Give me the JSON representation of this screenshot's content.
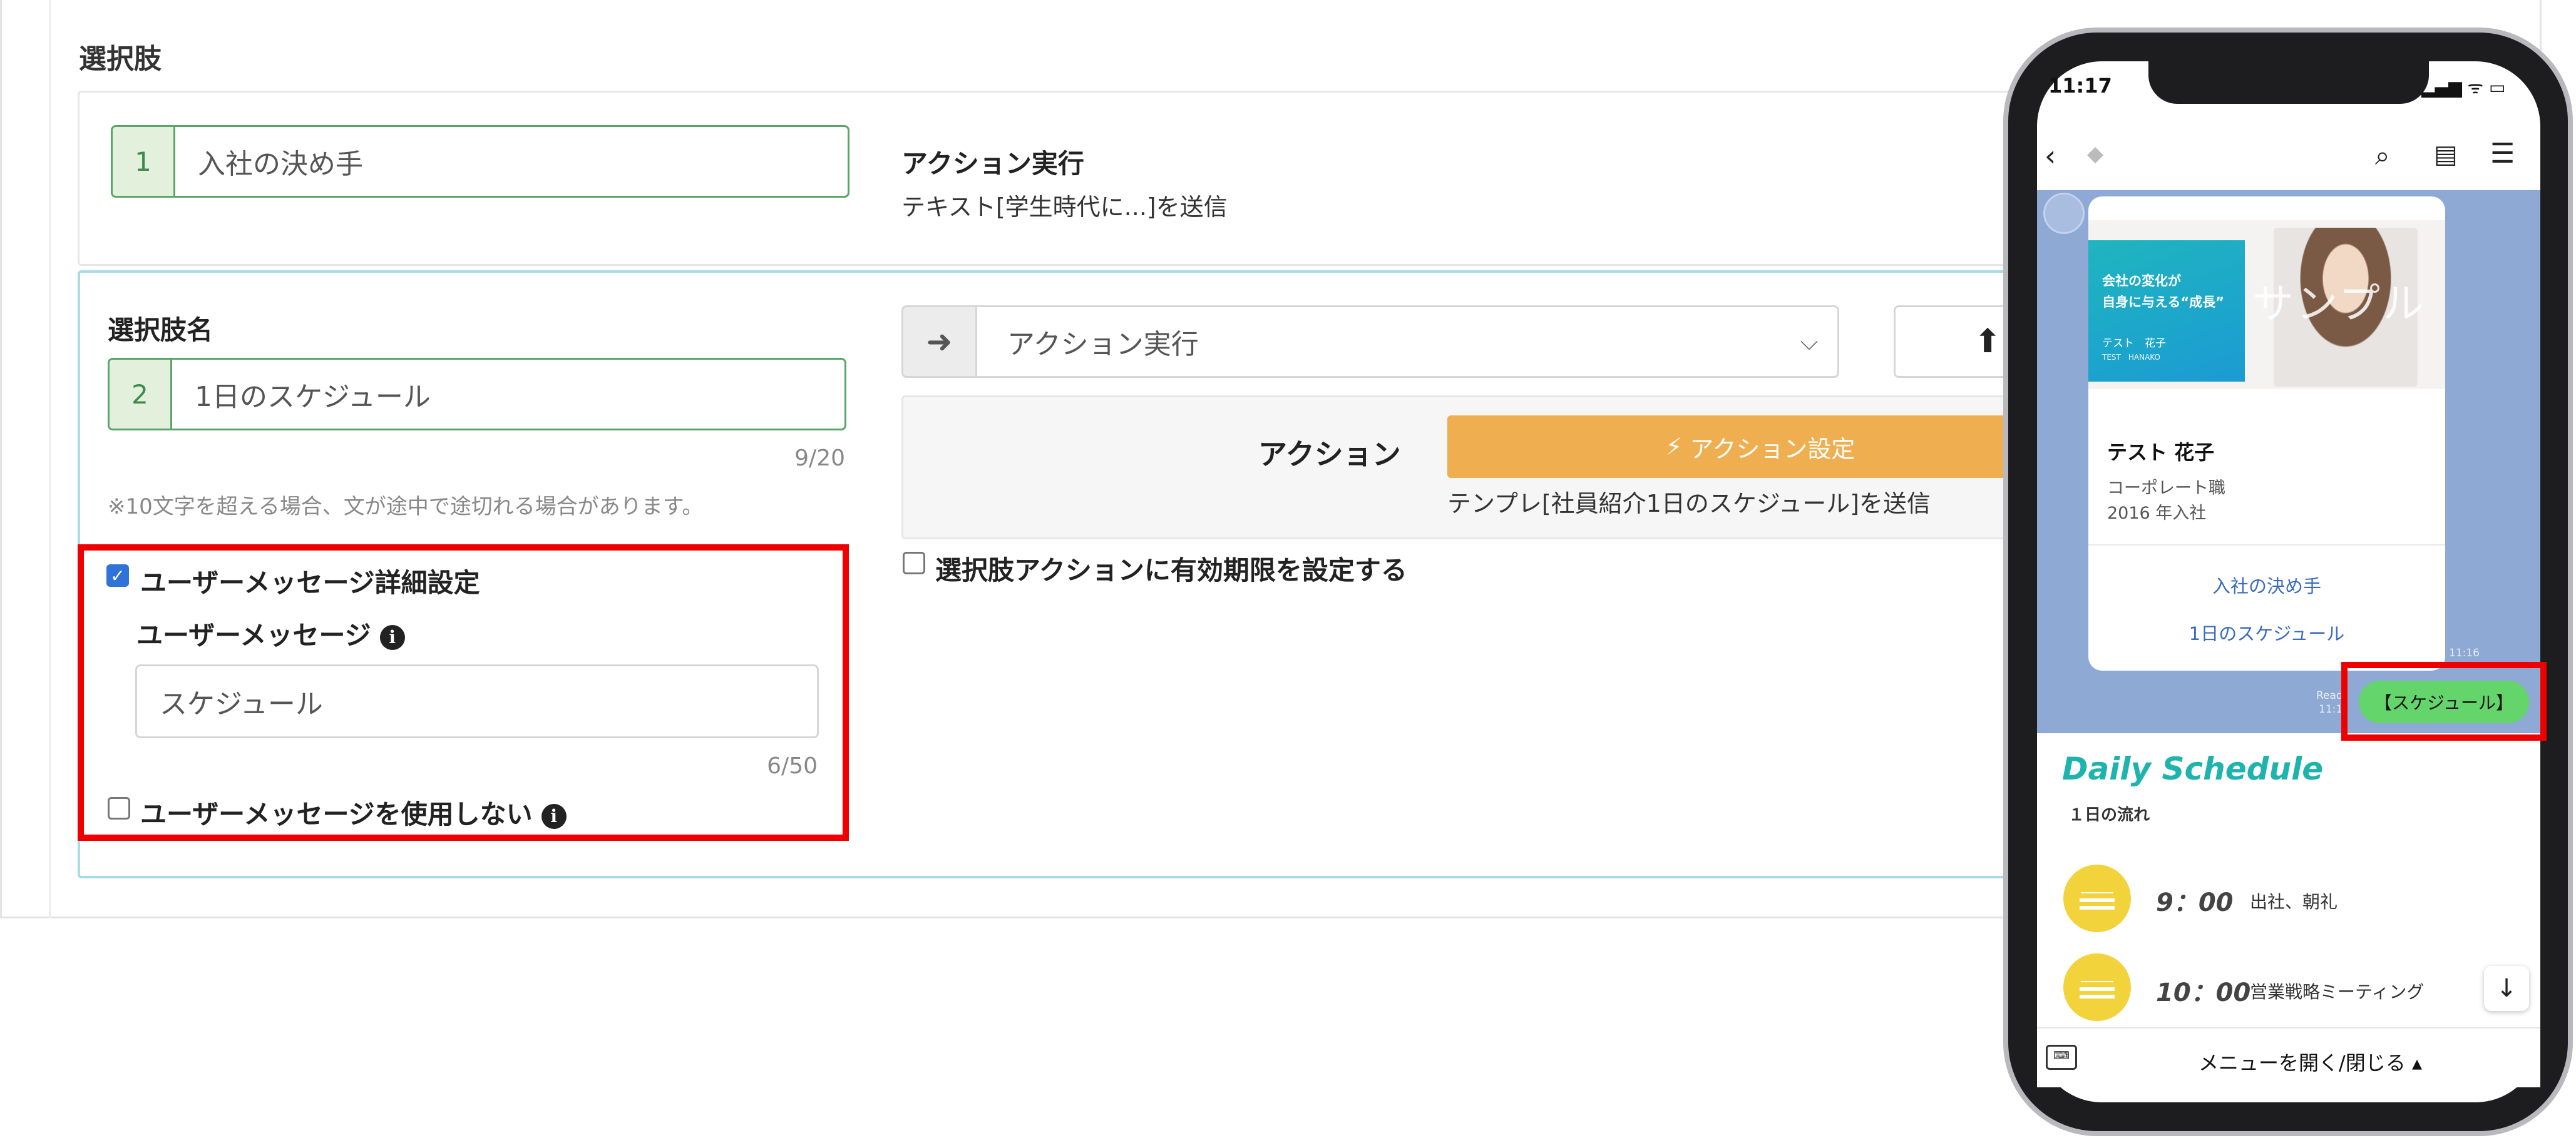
{
  "section": {
    "title": "選択肢"
  },
  "choice1": {
    "number": "1",
    "value": "入社の決め手",
    "action_title": "アクション実行",
    "action_desc": "テキスト[学生時代に...]を送信"
  },
  "choice2": {
    "label": "選択肢名",
    "number": "2",
    "value": "1日のスケジュール",
    "counter": "9/20",
    "hint": "※10文字を超える場合、文が途中で途切れる場合があります。",
    "select_value": "アクション実行",
    "action_label": "アクション",
    "action_button": "アクション設定",
    "action_desc": "テンプレ[社員紹介1日のスケジュール]を送信",
    "expiry_label": "選択肢アクションに有効期限を設定する",
    "detail_label": "ユーザーメッセージ詳細設定",
    "user_message_label": "ユーザーメッセージ",
    "user_message_value": "スケジュール",
    "user_message_counter": "6/50",
    "no_message_label": "ユーザーメッセージを使用しない"
  },
  "phone": {
    "time": "11:17",
    "card": {
      "headline1": "会社の変化が",
      "headline2": "自身に与える“成長”",
      "name_jp": "テスト　花子",
      "name_en": "TEST　HANAKO",
      "watermark": "サンプル",
      "person_name": "テスト 花子",
      "role": "コーポレート職",
      "year": "2016 年入社",
      "option1": "入社の決め手",
      "option2": "1日のスケジュール",
      "time": "11:16"
    },
    "read": "Read",
    "read_time": "11:1",
    "bubble": "【スケジュール】",
    "daily_title": "Daily Schedule",
    "daily_sub": "１日の流れ",
    "schedule": [
      {
        "time": "9：00",
        "text": "出社、朝礼"
      },
      {
        "time": "10：00",
        "text": "営業戦略ミーティング"
      }
    ],
    "menu": "メニューを開く/閉じる ▴"
  },
  "colors": {
    "green_border": "#5aa469",
    "accent_orange": "#efae4f",
    "highlight_red": "#ee0000",
    "chat_bg": "#8ea9d4"
  },
  "icons": [
    "arrow-right-icon",
    "chevron-down-icon",
    "arrow-up-icon",
    "lightning-icon",
    "info-icon",
    "back-icon",
    "search-icon",
    "note-icon",
    "menu-icon",
    "keyboard-icon",
    "arrow-down-icon",
    "sun-icon"
  ]
}
